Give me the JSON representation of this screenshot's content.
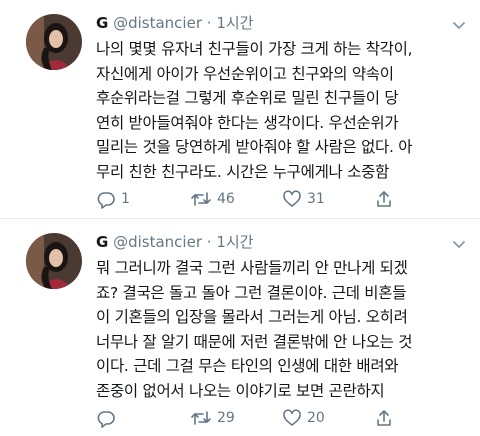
{
  "tweets": [
    {
      "name": "G",
      "handle": "@distancier",
      "separator": "·",
      "time": "1시간",
      "text": "나의 몇몇 유자녀 친구들이 가장 크게 하는 착각이,\n자신에게 아이가 우선순위이고 친구와의 약속이\n후순위라는걸 그렇게 후순위로 밀린 친구들이 당\n연히 받아들여줘야 한다는 생각이다. 우선순위가\n밀리는 것을 당연하게 받아줘야 할 사람은 없다. 아\n무리 친한 친구라도. 시간은 누구에게나 소중함",
      "replies": "1",
      "retweets": "46",
      "likes": "31"
    },
    {
      "name": "G",
      "handle": "@distancier",
      "separator": "·",
      "time": "1시간",
      "text": "뭐 그러니까 결국 그런 사람들끼리 안 만나게 되겠\n죠? 결국은 돌고 돌아 그런 결론이야. 근데 비혼들\n이 기혼들의 입장을 몰라서 그러는게 아님. 오히려\n너무나 잘 알기 때문에 저런 결론밖에 안 나오는 것\n이다. 근데 그걸 무슨 타인의 인생에 대한 배려와\n존중이 없어서 나오는 이야기로 보면 곤란하지",
      "replies": "",
      "retweets": "29",
      "likes": "20"
    }
  ],
  "icons": {
    "reply": "reply-icon",
    "retweet": "retweet-icon",
    "like": "heart-icon",
    "share": "share-icon",
    "menu": "chevron-down-icon"
  },
  "colors": {
    "text": "#14171a",
    "secondary": "#657786",
    "divider": "#e6ecf0"
  }
}
